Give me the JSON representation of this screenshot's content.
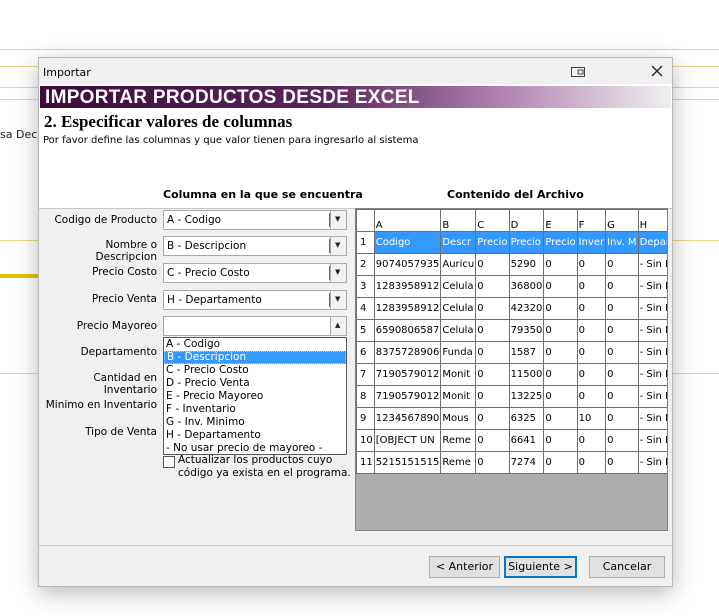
{
  "background": {
    "text": "sa Deci"
  },
  "window": {
    "title": "Importar"
  },
  "header": {
    "banner": "IMPORTAR PRODUCTOS DESDE EXCEL",
    "step_title": "2. Especificar valores de columnas",
    "step_subtitle": "Por favor define las columnas y que valor tienen para ingresarlo al sistema"
  },
  "mapping": {
    "column_header": "Columna en la que se encuentra",
    "fields": [
      {
        "label": "Codigo de Producto",
        "value": "A - Codigo"
      },
      {
        "label": "Nombre o Descripcion",
        "value": "B - Descripcion"
      },
      {
        "label": "Precio Costo",
        "value": "C - Precio Costo"
      },
      {
        "label": "Precio Venta",
        "value": "H - Departamento"
      },
      {
        "label": "Precio Mayoreo",
        "value": ""
      },
      {
        "label": "Departamento"
      },
      {
        "label": "Cantidad en Inventario"
      },
      {
        "label": "Minimo en Inventario"
      },
      {
        "label": "Tipo de Venta"
      }
    ],
    "dropdown_options": [
      "A - Codigo",
      "B - Descripcion",
      "C - Precio Costo",
      "D - Precio Venta",
      "E - Precio Mayoreo",
      "F - Inventario",
      "G - Inv. Minimo",
      "H - Departamento",
      "- No usar precio de mayoreo -"
    ],
    "dropdown_selected_index": 1,
    "checkbox_label_line1": "Actualizar los productos cuyo",
    "checkbox_label_line2": "código ya exista en el programa."
  },
  "file_contents": {
    "header": "Contenido del Archivo",
    "columns": [
      "A",
      "B",
      "C",
      "D",
      "E",
      "F",
      "G",
      "H"
    ],
    "rows": [
      {
        "n": "1",
        "cells": [
          "Codigo",
          "Descr",
          "Precio",
          "Precio",
          "Precio",
          "Inver",
          "Inv. M",
          "Depar"
        ]
      },
      {
        "n": "2",
        "cells": [
          "9074057935",
          "Auricu",
          "0",
          "5290",
          "0",
          "0",
          "0",
          "- Sin D"
        ]
      },
      {
        "n": "3",
        "cells": [
          "1283958912",
          "Celula",
          "0",
          "36800",
          "0",
          "0",
          "0",
          "- Sin D"
        ]
      },
      {
        "n": "4",
        "cells": [
          "1283958912",
          "Celula",
          "0",
          "42320",
          "0",
          "0",
          "0",
          "- Sin D"
        ]
      },
      {
        "n": "5",
        "cells": [
          "6590806587",
          "Celula",
          "0",
          "79350",
          "0",
          "0",
          "0",
          "- Sin D"
        ]
      },
      {
        "n": "6",
        "cells": [
          "8375728906",
          "Funda",
          "0",
          "1587",
          "0",
          "0",
          "0",
          "- Sin D"
        ]
      },
      {
        "n": "7",
        "cells": [
          "7190579012",
          "Monit",
          "0",
          "11500",
          "0",
          "0",
          "0",
          "- Sin D"
        ]
      },
      {
        "n": "8",
        "cells": [
          "7190579012",
          "Monit",
          "0",
          "13225",
          "0",
          "0",
          "0",
          "- Sin D"
        ]
      },
      {
        "n": "9",
        "cells": [
          "1234567890",
          "Mous",
          "0",
          "6325",
          "0",
          "10",
          "0",
          "- Sin D"
        ]
      },
      {
        "n": "10",
        "cells": [
          " [OBJECT UN",
          "Reme",
          "0",
          "6641",
          "0",
          "0",
          "0",
          "- Sin D"
        ]
      },
      {
        "n": "11",
        "cells": [
          "5215151515",
          "Reme",
          "0",
          "7274",
          "0",
          "0",
          "0",
          "- Sin D"
        ]
      }
    ]
  },
  "buttons": {
    "back": "< Anterior",
    "next": "Siguiente >",
    "cancel": "Cancelar"
  },
  "colors": {
    "banner_dark": "#3a0b3a",
    "selection": "#3399ff"
  }
}
